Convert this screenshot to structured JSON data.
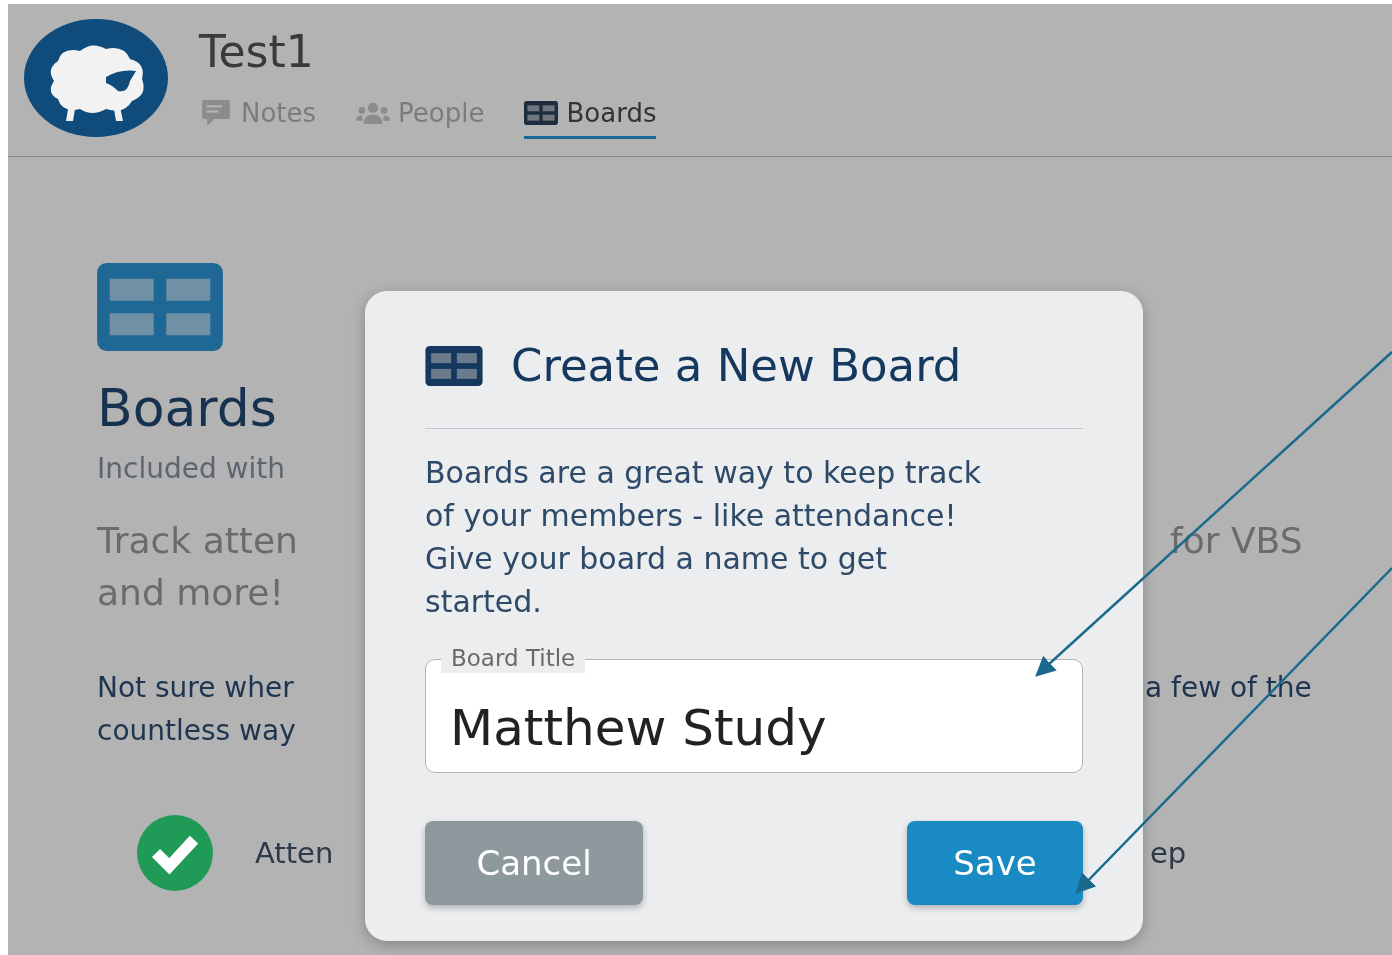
{
  "header": {
    "title": "Test1",
    "tabs": [
      {
        "label": "Notes",
        "selected": false
      },
      {
        "label": "People",
        "selected": false
      },
      {
        "label": "Boards",
        "selected": true
      }
    ]
  },
  "page": {
    "heading": "Boards",
    "subtitle": "Included with",
    "tagline": [
      {
        "left": "Track atten",
        "right": "for VBS"
      },
      {
        "left": "and more!"
      }
    ],
    "prompt": [
      {
        "left": "Not sure wher",
        "right": "a few of the"
      },
      {
        "left": "countless way"
      }
    ],
    "feature": {
      "checked": true,
      "left": "Atten",
      "right": "ep"
    }
  },
  "modal": {
    "title": "Create a New Board",
    "description": "Boards are a great way to keep track of your members - like attendance! Give your board a name to get started.",
    "field": {
      "label": "Board Title",
      "value": "Matthew Study"
    },
    "buttons": [
      {
        "label": "Cancel",
        "kind": "secondary"
      },
      {
        "label": "Save",
        "kind": "primary"
      }
    ]
  }
}
